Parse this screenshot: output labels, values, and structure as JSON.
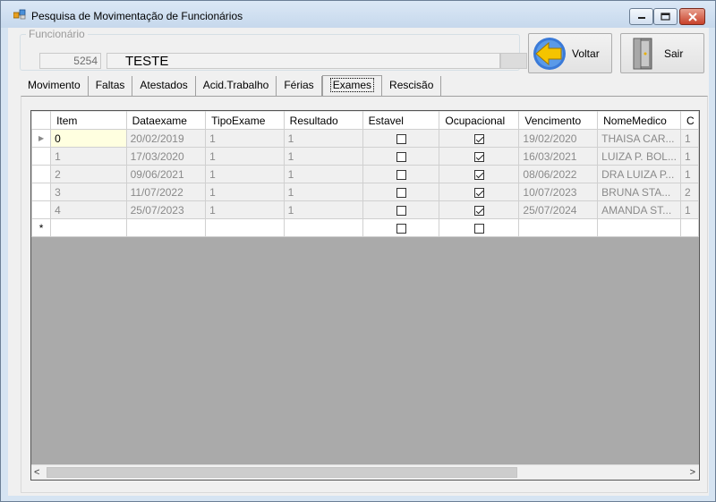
{
  "window": {
    "title": "Pesquisa de Movimentação de Funcionários",
    "controls": {
      "minimize": "—",
      "maximize": "□",
      "close": "✕"
    }
  },
  "funcionario": {
    "legend": "Funcionário",
    "code": "5254",
    "name": "TESTE"
  },
  "buttons": {
    "voltar": "Voltar",
    "sair": "Sair"
  },
  "tabs": [
    "Movimento",
    "Faltas",
    "Atestados",
    "Acid.Trabalho",
    "Férias",
    "Exames",
    "Rescisão"
  ],
  "active_tab": "Exames",
  "grid": {
    "columns": [
      "Item",
      "Dataexame",
      "TipoExame",
      "Resultado",
      "Estavel",
      "Ocupacional",
      "Vencimento",
      "NomeMedico",
      "C"
    ],
    "rows": [
      {
        "item": "0",
        "dataexame": "20/02/2019",
        "tipoexame": "1",
        "resultado": "1",
        "estavel": false,
        "ocupacional": true,
        "vencimento": "19/02/2020",
        "nomemedico": "THAISA CAR...",
        "extra": "1"
      },
      {
        "item": "1",
        "dataexame": "17/03/2020",
        "tipoexame": "1",
        "resultado": "1",
        "estavel": false,
        "ocupacional": true,
        "vencimento": "16/03/2021",
        "nomemedico": "LUIZA P. BOL...",
        "extra": "1"
      },
      {
        "item": "2",
        "dataexame": "09/06/2021",
        "tipoexame": "1",
        "resultado": "1",
        "estavel": false,
        "ocupacional": true,
        "vencimento": "08/06/2022",
        "nomemedico": "DRA LUIZA P...",
        "extra": "1"
      },
      {
        "item": "3",
        "dataexame": "11/07/2022",
        "tipoexame": "1",
        "resultado": "1",
        "estavel": false,
        "ocupacional": true,
        "vencimento": "10/07/2023",
        "nomemedico": "BRUNA STA...",
        "extra": "2"
      },
      {
        "item": "4",
        "dataexame": "25/07/2023",
        "tipoexame": "1",
        "resultado": "1",
        "estavel": false,
        "ocupacional": true,
        "vencimento": "25/07/2024",
        "nomemedico": "AMANDA ST...",
        "extra": "1"
      }
    ],
    "current_row_marker": "▶",
    "new_row_marker": "*"
  },
  "scrollbar": {
    "left_arrow": "<",
    "right_arrow": ">"
  },
  "colors": {
    "title_bg": "#c6d8ec",
    "grid_bg": "#aaaaaa",
    "current_cell": "#ffffe0",
    "close_button": "#c8412a",
    "arrow_yellow": "#f5c400",
    "arrow_blue": "#3a7ad8"
  },
  "icons": {
    "title": "app-form-icon",
    "voltar": "back-arrow-icon",
    "sair": "exit-door-icon"
  }
}
